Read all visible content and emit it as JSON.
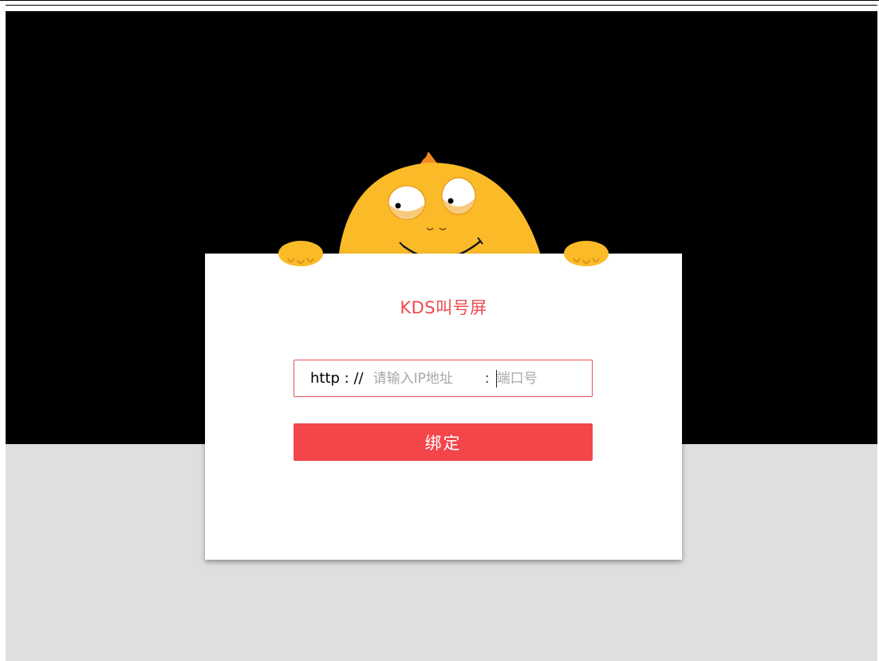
{
  "app": {
    "title": "KDS叫号屏"
  },
  "form": {
    "url_prefix": "http : //",
    "ip_placeholder": "请输入IP地址",
    "port_separator": ":",
    "port_placeholder": "端口号",
    "bind_label": "绑定"
  },
  "colors": {
    "accent": "#f3454a",
    "title": "#ef4a4d",
    "mascot": "#fbbb28",
    "crest": "#f08a1f",
    "top_background": "#000000",
    "bottom_background": "#dfdee0"
  },
  "icons": {
    "mascot": "yellow-blob-mascot"
  }
}
